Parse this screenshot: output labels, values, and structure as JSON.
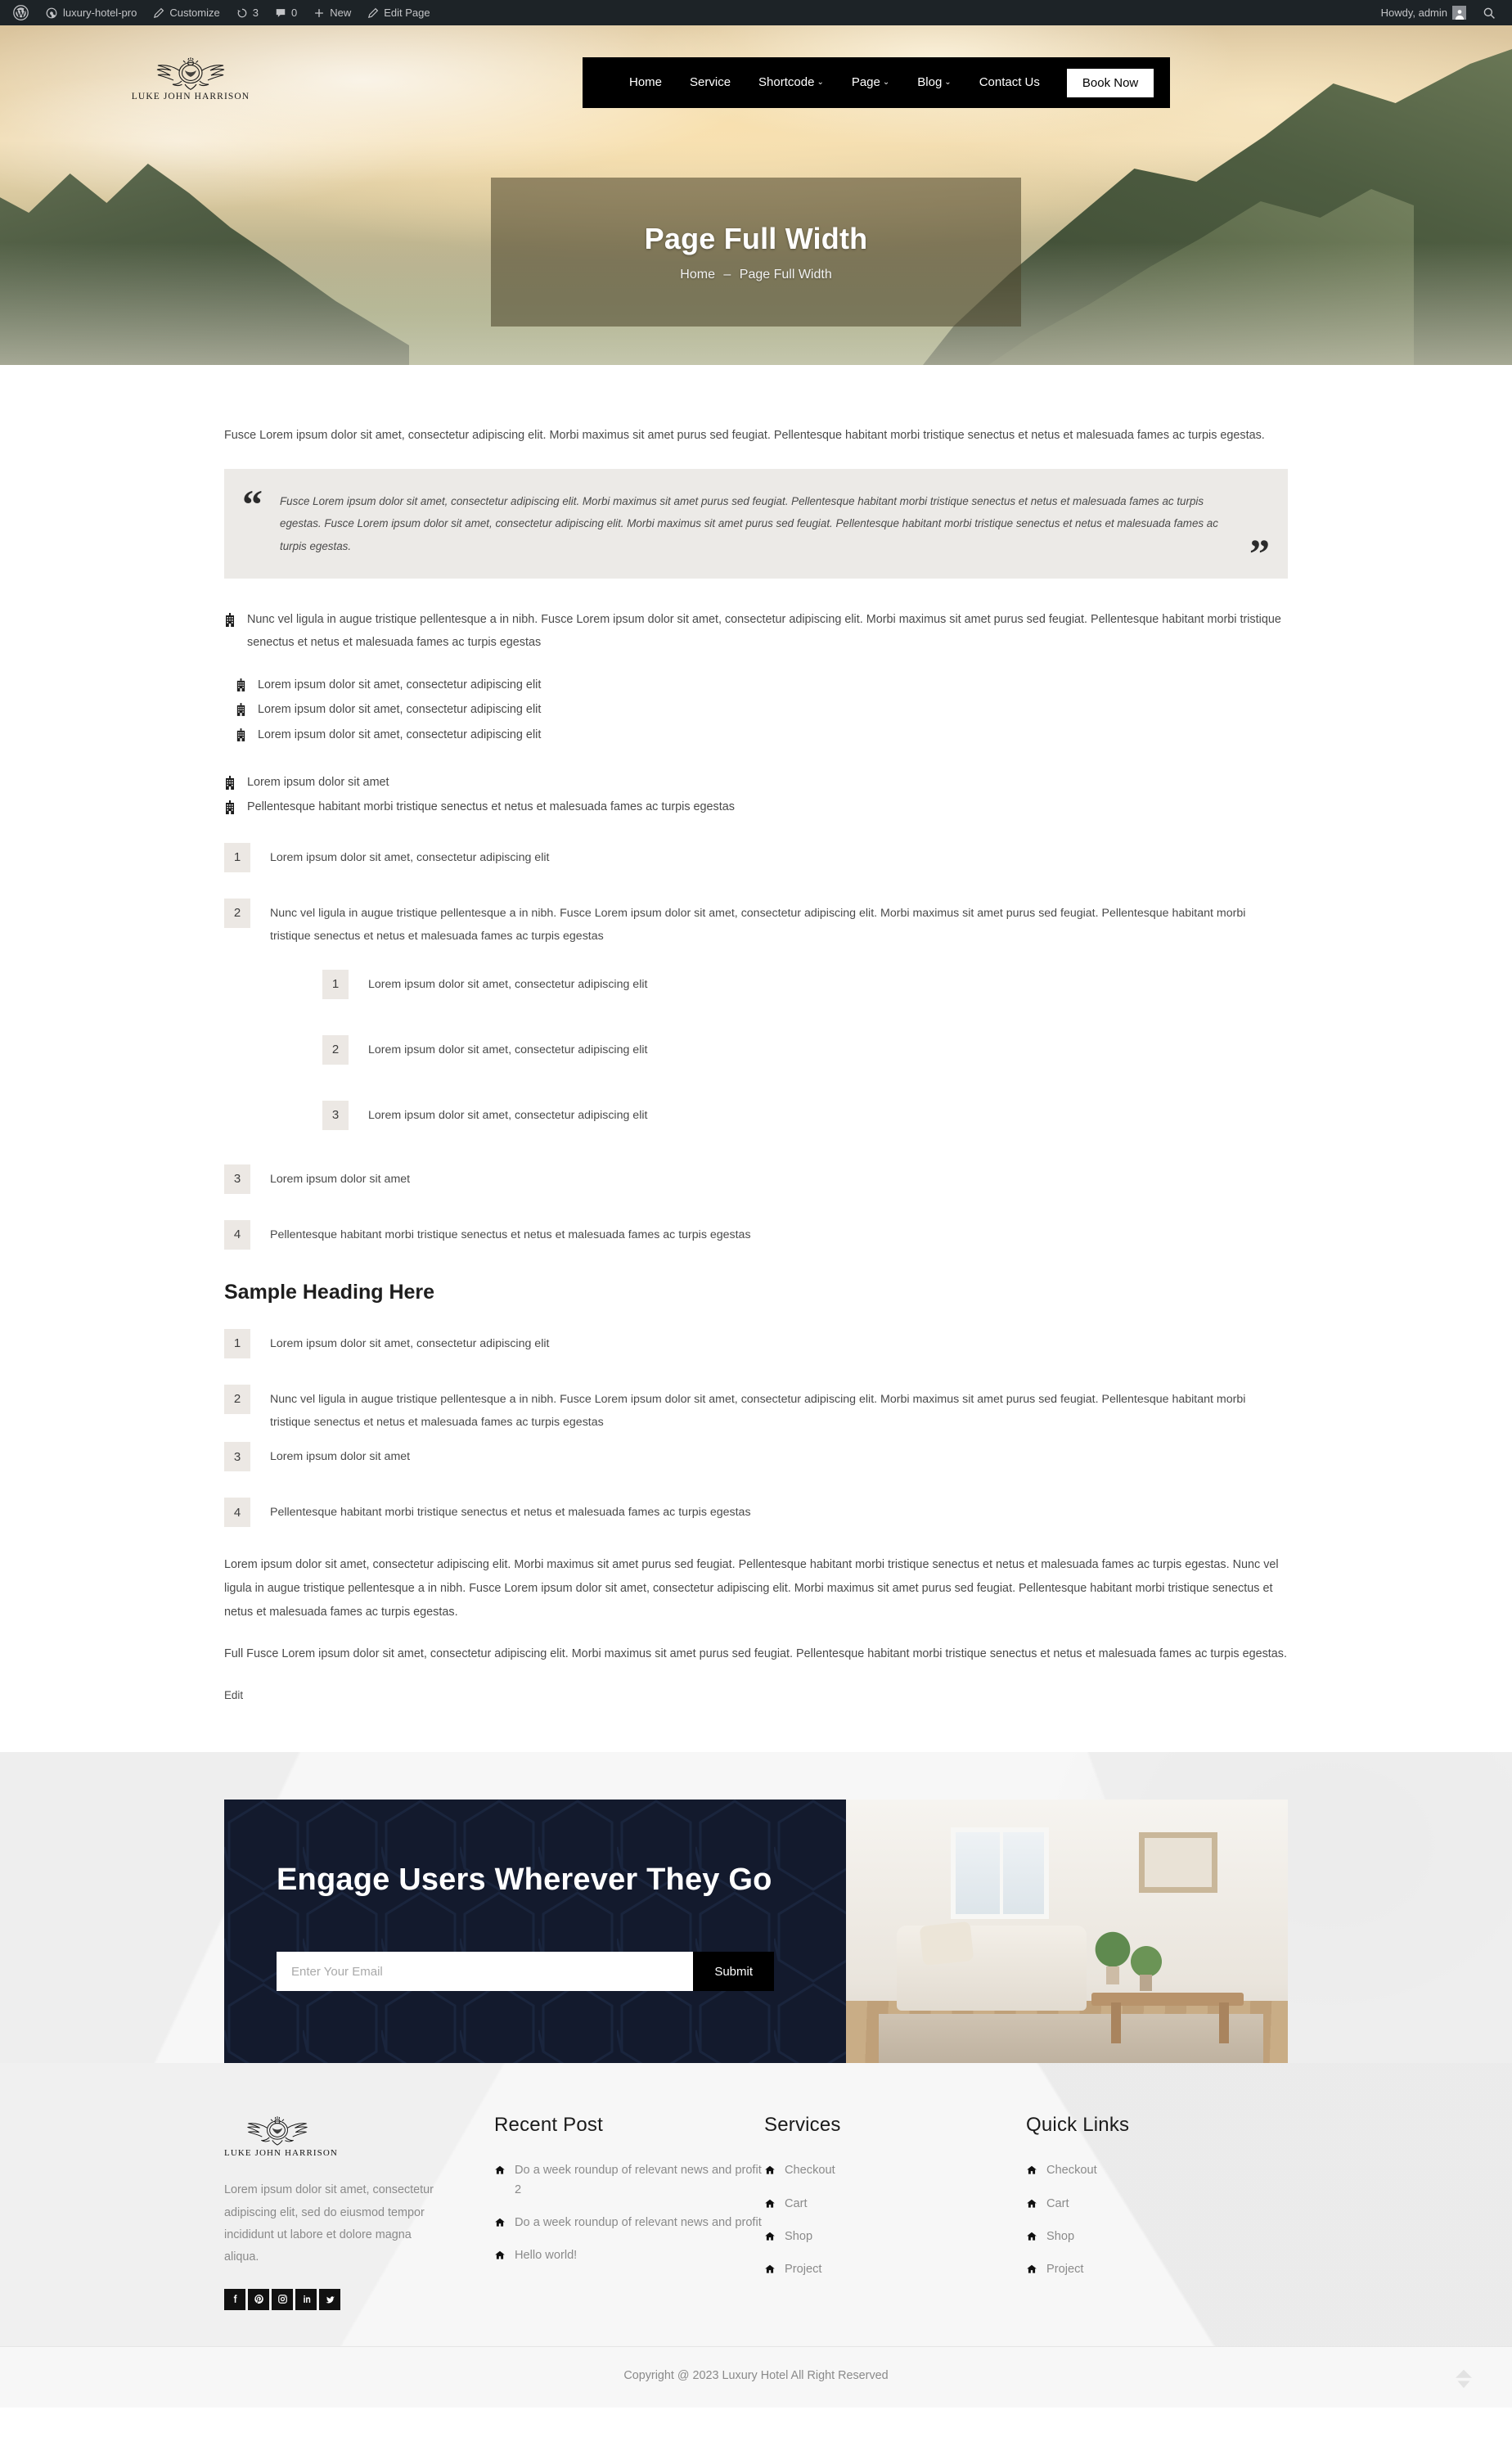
{
  "admin_bar": {
    "wp_logo_icon": "wordpress-logo-icon",
    "site_name": "luxury-hotel-pro",
    "site_icon": "dashboard-icon",
    "customize": "Customize",
    "customize_icon": "pencil-icon",
    "updates_count": "3",
    "updates_icon": "updates-icon",
    "comments_count": "0",
    "comments_icon": "comment-icon",
    "new": "New",
    "new_icon": "plus-icon",
    "edit_page": "Edit Page",
    "edit_page_icon": "pencil-icon",
    "howdy": "Howdy, admin",
    "avatar_icon": "user-avatar-icon",
    "search_icon": "search-icon"
  },
  "header": {
    "logo_title": "LUKE JOHN HARRISON",
    "logo_icon": "winged-crest-logo-icon",
    "nav": [
      {
        "label": "Home",
        "has_caret": false
      },
      {
        "label": "Service",
        "has_caret": false
      },
      {
        "label": "Shortcode",
        "has_caret": true
      },
      {
        "label": "Page",
        "has_caret": true
      },
      {
        "label": "Blog",
        "has_caret": true
      },
      {
        "label": "Contact Us",
        "has_caret": false
      }
    ],
    "caret_glyph": "⌄",
    "cta_label": "Book Now"
  },
  "page_title": {
    "title": "Page Full Width",
    "crumb_home": "Home",
    "crumb_sep": "–",
    "crumb_current": "Page Full Width"
  },
  "content": {
    "intro": "Fusce Lorem ipsum dolor sit amet, consectetur adipiscing elit. Morbi maximus sit amet purus sed feugiat. Pellentesque habitant morbi tristique senectus et netus et malesuada fames ac turpis egestas.",
    "quote_open": "“",
    "quote_close": "”",
    "quote": "Fusce Lorem ipsum dolor sit amet, consectetur adipiscing elit. Morbi maximus sit amet purus sed feugiat. Pellentesque habitant morbi tristique senectus et netus et malesuada fames ac turpis egestas. Fusce Lorem ipsum dolor sit amet, consectetur adipiscing elit. Morbi maximus sit amet purus sed feugiat. Pellentesque habitant morbi tristique senectus et netus et malesuada fames ac turpis egestas.",
    "bullet_icon": "hotel-building-icon",
    "icon_list_a": [
      "Nunc vel ligula in augue tristique pellentesque a in nibh. Fusce Lorem ipsum dolor sit amet, consectetur adipiscing elit. Morbi maximus sit amet purus sed feugiat. Pellentesque habitant morbi tristique senectus et netus et malesuada fames ac turpis egestas",
      "Lorem ipsum dolor sit amet, consectetur adipiscing elit",
      "Lorem ipsum dolor sit amet, consectetur adipiscing elit",
      "Lorem ipsum dolor sit amet, consectetur adipiscing elit"
    ],
    "icon_list_b": [
      "Lorem ipsum dolor sit amet",
      "Pellentesque habitant morbi tristique senectus et netus et malesuada fames ac turpis egestas"
    ],
    "num_list_1": [
      {
        "n": "1",
        "text": "Lorem ipsum dolor sit amet, consectetur adipiscing elit"
      },
      {
        "n": "2",
        "text": "Nunc vel ligula in augue tristique pellentesque a in nibh. Fusce Lorem ipsum dolor sit amet, consectetur adipiscing elit. Morbi maximus sit amet purus sed feugiat. Pellentesque habitant morbi tristique senectus et netus et malesuada fames ac turpis egestas"
      },
      {
        "n": "3",
        "text": "Lorem ipsum dolor sit amet"
      },
      {
        "n": "4",
        "text": "Pellentesque habitant morbi tristique senectus et netus et malesuada fames ac turpis egestas"
      }
    ],
    "sub_list": [
      {
        "n": "1",
        "text": "Lorem ipsum dolor sit amet, consectetur adipiscing elit"
      },
      {
        "n": "2",
        "text": "Lorem ipsum dolor sit amet, consectetur adipiscing elit"
      },
      {
        "n": "3",
        "text": "Lorem ipsum dolor sit amet, consectetur adipiscing elit"
      }
    ],
    "sample_heading": "Sample Heading Here",
    "num_list_2": [
      {
        "n": "1",
        "text": "Lorem ipsum dolor sit amet, consectetur adipiscing elit"
      },
      {
        "n": "2",
        "text": "Nunc vel ligula in augue tristique pellentesque a in nibh. Fusce Lorem ipsum dolor sit amet, consectetur adipiscing elit. Morbi maximus sit amet purus sed feugiat. Pellentesque habitant morbi tristique senectus et netus et malesuada fames ac turpis egestas"
      },
      {
        "n": "3",
        "text": "Lorem ipsum dolor sit amet"
      },
      {
        "n": "4",
        "text": "Pellentesque habitant morbi tristique senectus et netus et malesuada fames ac turpis egestas"
      }
    ],
    "tail_para_1": "Lorem ipsum dolor sit amet, consectetur adipiscing elit. Morbi maximus sit amet purus sed feugiat. Pellentesque habitant morbi tristique senectus et netus et malesuada fames ac turpis egestas. Nunc vel ligula in augue tristique pellentesque a in nibh. Fusce Lorem ipsum dolor sit amet, consectetur adipiscing elit. Morbi maximus sit amet purus sed feugiat. Pellentesque habitant morbi tristique senectus et netus et malesuada fames ac turpis egestas.",
    "tail_para_2": "Full Fusce Lorem ipsum dolor sit amet, consectetur adipiscing elit. Morbi maximus sit amet purus sed feugiat. Pellentesque habitant morbi tristique senectus et netus et malesuada fames ac turpis egestas.",
    "edit_link": "Edit"
  },
  "cta": {
    "heading": "Engage Users Wherever They Go",
    "email_placeholder": "Enter Your Email",
    "email_value": "",
    "submit_label": "Submit",
    "bg_color": "#131a2d",
    "image_alt": "hotel-room-image"
  },
  "footer": {
    "logo_title": "LUKE JOHN HARRISON",
    "logo_icon": "winged-crest-logo-icon",
    "about": "Lorem ipsum dolor sit amet, consectetur adipiscing elit, sed do eiusmod tempor incididunt ut labore et dolore magna aliqua.",
    "socials": [
      {
        "name": "facebook-icon"
      },
      {
        "name": "pinterest-icon"
      },
      {
        "name": "instagram-icon"
      },
      {
        "name": "linkedin-icon"
      },
      {
        "name": "twitter-icon"
      }
    ],
    "link_icon": "home-icon",
    "columns": [
      {
        "title": "Recent Post",
        "links": [
          "Do a week roundup of relevant news and profit 2",
          "Do a week roundup of relevant news and profit",
          "Hello world!"
        ]
      },
      {
        "title": "Services",
        "links": [
          "Checkout",
          "Cart",
          "Shop",
          "Project"
        ]
      },
      {
        "title": "Quick Links",
        "links": [
          "Checkout",
          "Cart",
          "Shop",
          "Project"
        ]
      }
    ],
    "copyright": "Copyright @ 2023 Luxury Hotel All Right Reserved",
    "scroll_top_icon": "scroll-to-top-icon"
  }
}
